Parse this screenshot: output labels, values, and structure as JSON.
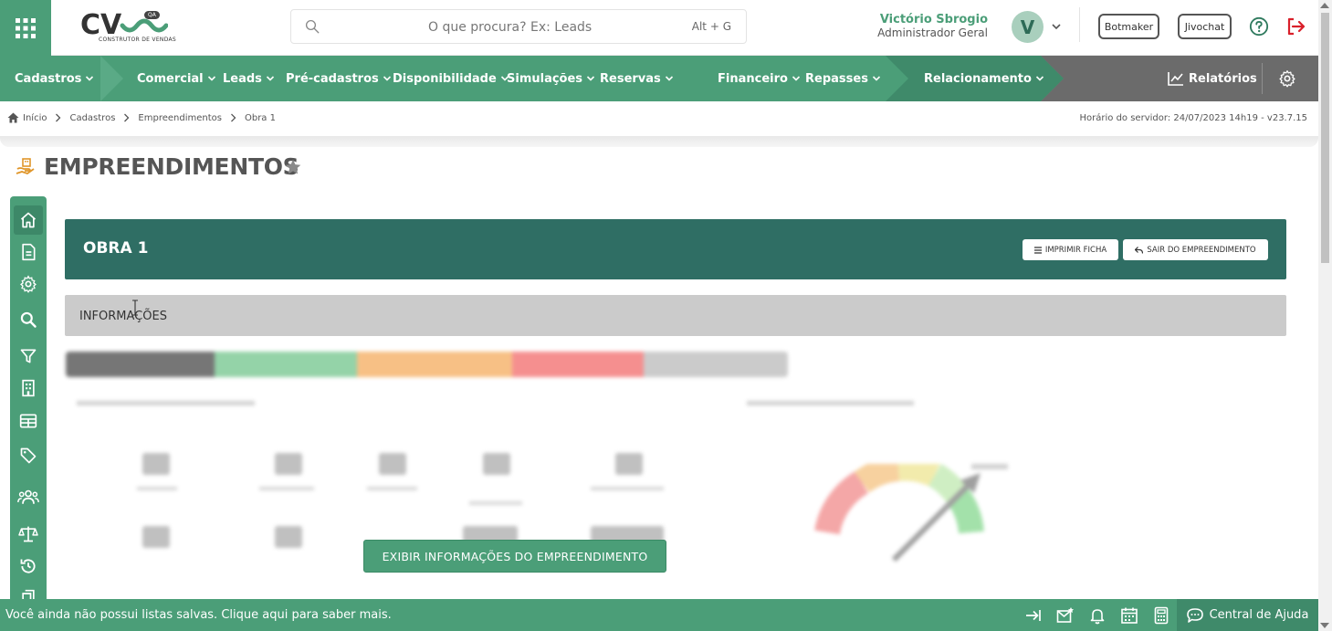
{
  "header": {
    "logo_text": "CV",
    "logo_subtitle": "CONSTRUTOR DE VENDAS",
    "env_badge": "QA",
    "search_placeholder": "O que procura? Ex: Leads",
    "search_shortcut": "Alt + G",
    "user_name": "Victório Sbrogio",
    "user_role": "Administrador Geral",
    "avatar_initial": "V",
    "botmaker_label": "Botmaker",
    "jivochat_label": "Jivochat",
    "icons": [
      "apps-grid-icon",
      "search-icon",
      "chevron-down-icon",
      "help-circle-icon",
      "logout-icon"
    ]
  },
  "nav": {
    "items": [
      {
        "label": "Cadastros"
      },
      {
        "label": "Comercial"
      },
      {
        "label": "Leads"
      },
      {
        "label": "Pré-cadastros"
      },
      {
        "label": "Disponibilidade"
      },
      {
        "label": "Simulações"
      },
      {
        "label": "Reservas"
      },
      {
        "label": "Financeiro"
      },
      {
        "label": "Repasses"
      },
      {
        "label": "Relacionamento"
      }
    ],
    "reports_label": "Relatórios",
    "colors": {
      "primary": "#4b9e78",
      "gray": "#6b6b6b"
    }
  },
  "breadcrumb": {
    "items": [
      "Início",
      "Cadastros",
      "Empreendimentos",
      "Obra 1"
    ],
    "server_time": "Horário do servidor: 24/07/2023 14h19 - v23.7.15"
  },
  "page": {
    "title": "EMPREENDIMENTOS",
    "obra_title": "OBRA 1",
    "print_label": "IMPRIMIR FICHA",
    "exit_label": "SAIR DO EMPREENDIMENTO",
    "info_label": "INFORMAÇÕES",
    "show_info_button": "EXIBIR INFORMAÇÕES DO EMPREENDIMENTO",
    "banner_color": "#2f6e64"
  },
  "rail": {
    "icons": [
      "home-icon",
      "document-icon",
      "settings-icon",
      "search-icon",
      "filter-icon",
      "building-icon",
      "table-icon",
      "tag-icon",
      "users-icon",
      "scale-icon",
      "history-icon",
      "file-icon"
    ]
  },
  "footer": {
    "message": "Você ainda não possui listas salvas. Clique aqui para saber mais.",
    "help_center_label": "Central de Ajuda",
    "icons": [
      "arrow-to-right-icon",
      "mail-star-icon",
      "bell-icon",
      "calendar-icon",
      "calculator-icon",
      "chat-bubble-icon"
    ]
  }
}
